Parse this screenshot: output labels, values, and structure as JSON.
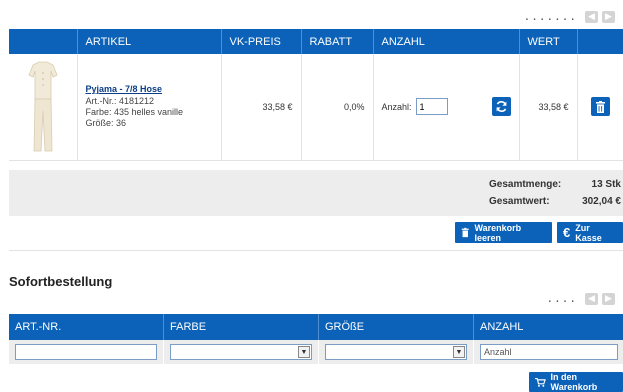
{
  "pager_top": {
    "dots": ".......",
    "prev_icon": "chevron-left-icon",
    "next_icon": "chevron-right-icon"
  },
  "cart_table": {
    "headers": [
      "",
      "ARTIKEL",
      "VK-PREIS",
      "RABATT",
      "ANZAHL",
      "WERT",
      ""
    ],
    "item": {
      "name": "Pyjama - 7/8 Hose",
      "art_nr": "Art.-Nr.: 4181212",
      "color": "Farbe: 435  helles vanille",
      "size": "Größe: 36",
      "price": "33,58 €",
      "discount": "0,0%",
      "qty_label": "Anzahl:",
      "qty_value": "1",
      "total": "33,58 €",
      "refresh_icon": "refresh-icon",
      "delete_icon": "trash-icon"
    }
  },
  "summary": {
    "qty_label": "Gesamtmenge:",
    "qty_value": "13 Stk",
    "total_label": "Gesamtwert:",
    "total_value": "302,04 €"
  },
  "buttons": {
    "empty_cart": "Warenkorb leeren",
    "checkout": "Zur Kasse",
    "add_to_cart": "In den Warenkorb"
  },
  "quick_order": {
    "title": "Sofortbestellung",
    "pager_dots": "....",
    "headers": [
      "ART.-NR.",
      "FARBE",
      "GRÖßE",
      "ANZAHL"
    ],
    "art_nr_value": "",
    "color_value": "",
    "size_value": "",
    "qty_placeholder": "Anzahl"
  },
  "colors": {
    "accent": "#0b62b8",
    "summary_bg": "#ededed"
  }
}
